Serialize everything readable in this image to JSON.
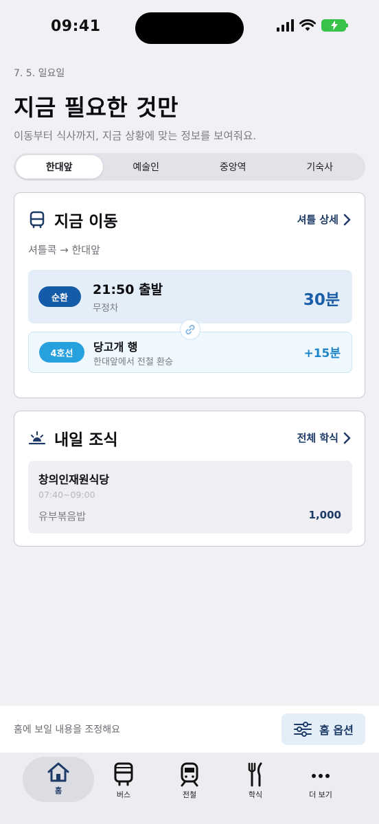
{
  "status_bar": {
    "time": "09:41"
  },
  "header": {
    "date": "7. 5. 일요일",
    "title": "지금 필요한 것만",
    "subtitle": "이동부터 식사까지, 지금 상황에 맞는 정보를 보여줘요."
  },
  "segments": [
    {
      "label": "한대앞",
      "selected": true
    },
    {
      "label": "예술인",
      "selected": false
    },
    {
      "label": "중앙역",
      "selected": false
    },
    {
      "label": "기숙사",
      "selected": false
    }
  ],
  "move_card": {
    "title": "지금 이동",
    "link_label": "셔틀 상세",
    "route": "셔틀콕 → 한대앞",
    "shuttle": {
      "badge": "순환",
      "time": "21:50 출발",
      "note": "무정차",
      "minutes": "30분"
    },
    "transfer": {
      "badge": "4호선",
      "title": "당고개 행",
      "note": "한대앞에서 전철 환승",
      "extra": "+15분"
    }
  },
  "meal_card": {
    "title": "내일 조식",
    "link_label": "전체 학식",
    "place": "창의인재원식당",
    "hours": "07:40~09:00",
    "menu": "유부볶음밥",
    "price": "1,000"
  },
  "home_options": {
    "text": "홈에 보일 내용을 조정해요",
    "button_label": "홈 옵션"
  },
  "tabs": [
    {
      "label": "홈",
      "icon": "home-icon",
      "active": true
    },
    {
      "label": "버스",
      "icon": "bus-icon",
      "active": false
    },
    {
      "label": "전철",
      "icon": "train-icon",
      "active": false
    },
    {
      "label": "학식",
      "icon": "fork-knife-icon",
      "active": false
    },
    {
      "label": "더 보기",
      "icon": "more-icon",
      "active": false
    }
  ],
  "colors": {
    "accent_navy": "#1d3a67",
    "shuttle_blue": "#155ca8",
    "line4_blue": "#27a1de",
    "background": "#f1f1f5"
  }
}
